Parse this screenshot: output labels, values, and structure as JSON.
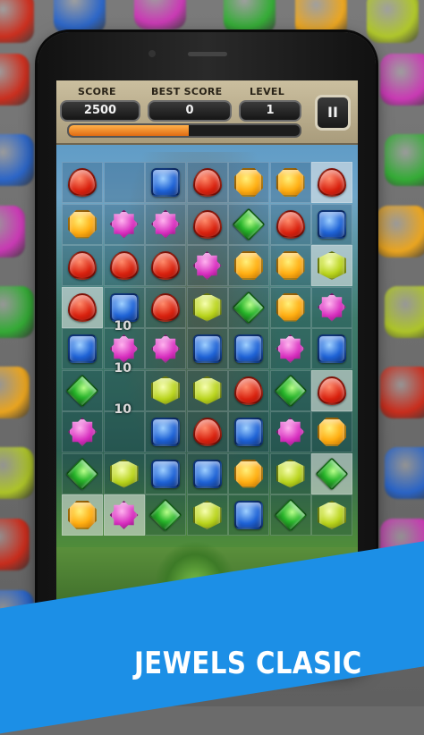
{
  "hud": {
    "score_label": "SCORE",
    "score_value": "2500",
    "best_label": "BEST SCORE",
    "best_value": "0",
    "level_label": "LEVEL",
    "level_value": "1",
    "pause_label": "II",
    "progress_fraction": 0.52
  },
  "board": {
    "rows": [
      [
        "red",
        "none",
        "blue",
        "red",
        "orange",
        "orange",
        "red"
      ],
      [
        "orange",
        "pink",
        "pink",
        "red",
        "green",
        "red",
        "blue"
      ],
      [
        "red",
        "red",
        "red",
        "pink",
        "orange",
        "orange",
        "yellow"
      ],
      [
        "red",
        "blue",
        "red",
        "yellow",
        "green",
        "orange",
        "pink"
      ],
      [
        "blue",
        "pink",
        "pink",
        "blue",
        "blue",
        "special",
        "blue"
      ],
      [
        "green",
        "none",
        "yellow",
        "yellow",
        "red",
        "green",
        "red"
      ],
      [
        "pink",
        "none",
        "blue",
        "red",
        "blue",
        "pink",
        "orange"
      ],
      [
        "green",
        "yellow",
        "blue",
        "blue",
        "orange",
        "yellow",
        "green"
      ],
      [
        "orange",
        "pink",
        "green",
        "yellow",
        "blue",
        "green",
        "yellow"
      ]
    ],
    "light_cells": [
      [
        0,
        6
      ],
      [
        2,
        6
      ],
      [
        3,
        0
      ],
      [
        5,
        6
      ],
      [
        7,
        6
      ],
      [
        8,
        0
      ],
      [
        8,
        1
      ]
    ],
    "floating_scores": [
      "10",
      "10",
      "10"
    ]
  },
  "banner": {
    "title": "JEWELS CLASIC",
    "color": "#1c8fe6"
  }
}
